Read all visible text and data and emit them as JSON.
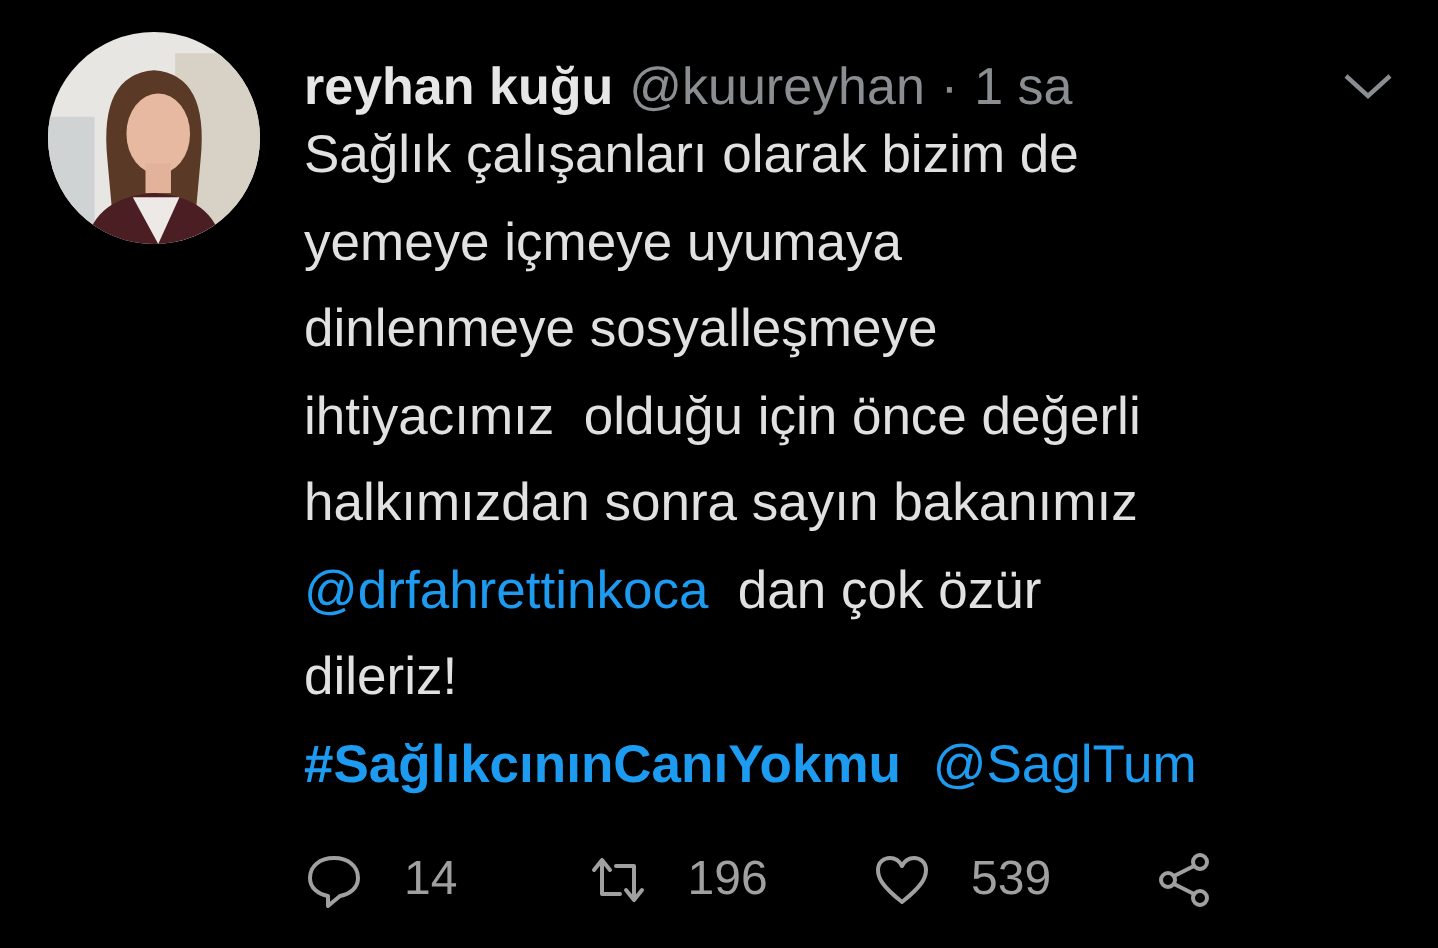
{
  "tweet": {
    "author_name": "reyhan kuğu",
    "handle": "@kuureyhan",
    "separator": "·",
    "time": "1 sa",
    "lines": [
      [
        {
          "kind": "text",
          "text": "Sağlık çalışanları olarak bizim de"
        }
      ],
      [
        {
          "kind": "text",
          "text": "yemeye içmeye uyumaya"
        }
      ],
      [
        {
          "kind": "text",
          "text": "dinlenmeye sosyalleşmeye"
        }
      ],
      [
        {
          "kind": "text",
          "text": "ihtiyacımız  olduğu için önce değerli"
        }
      ],
      [
        {
          "kind": "text",
          "text": "halkımızdan sonra sayın bakanımız"
        }
      ],
      [
        {
          "kind": "mention",
          "text": "@drfahrettinkoca"
        },
        {
          "kind": "text",
          "text": "  dan çok özür"
        }
      ],
      [
        {
          "kind": "text",
          "text": "dileriz!"
        }
      ],
      [
        {
          "kind": "hashtag",
          "text": "#SağlıkcınınCanıYokmu"
        },
        {
          "kind": "mention",
          "text": "@SaglTum"
        }
      ]
    ],
    "actions": [
      {
        "kind": "reply",
        "count": "14"
      },
      {
        "kind": "retweet",
        "count": "196"
      },
      {
        "kind": "like",
        "count": "539"
      },
      {
        "kind": "share"
      }
    ]
  }
}
